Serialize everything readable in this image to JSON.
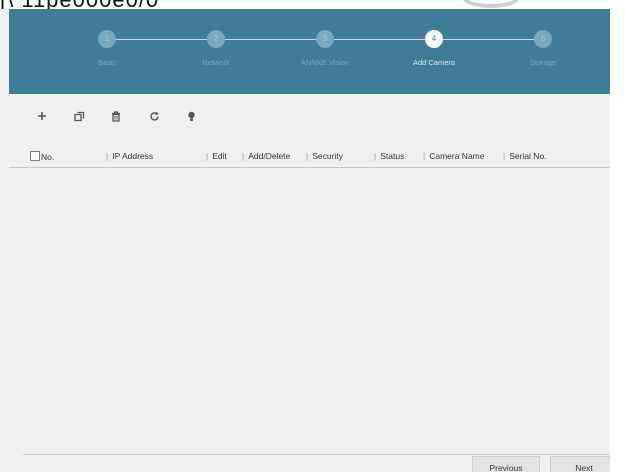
{
  "overlay": {
    "cropped_text": "[\\ 11pe000e0/0"
  },
  "wizard": {
    "steps": [
      {
        "number": "1",
        "label": "Basic"
      },
      {
        "number": "2",
        "label": "Network"
      },
      {
        "number": "3",
        "label": "ANNKE Vision"
      },
      {
        "number": "4",
        "label": "Add Camera"
      },
      {
        "number": "5",
        "label": "Storage"
      }
    ],
    "active_step": 4
  },
  "toolbar": {
    "icons": [
      "add-icon",
      "copy-icon",
      "delete-icon",
      "refresh-icon",
      "bulb-icon"
    ]
  },
  "table": {
    "columns": [
      "No.",
      "IP Address",
      "Edit",
      "Add/Delete",
      "Security",
      "Status",
      "Camera Name",
      "Serial No."
    ],
    "rows": []
  },
  "footer": {
    "previous_label": "Previous",
    "next_label": "Next"
  },
  "colors": {
    "header_bg": "#3f7c97",
    "page_bg": "#f0f0f0"
  }
}
